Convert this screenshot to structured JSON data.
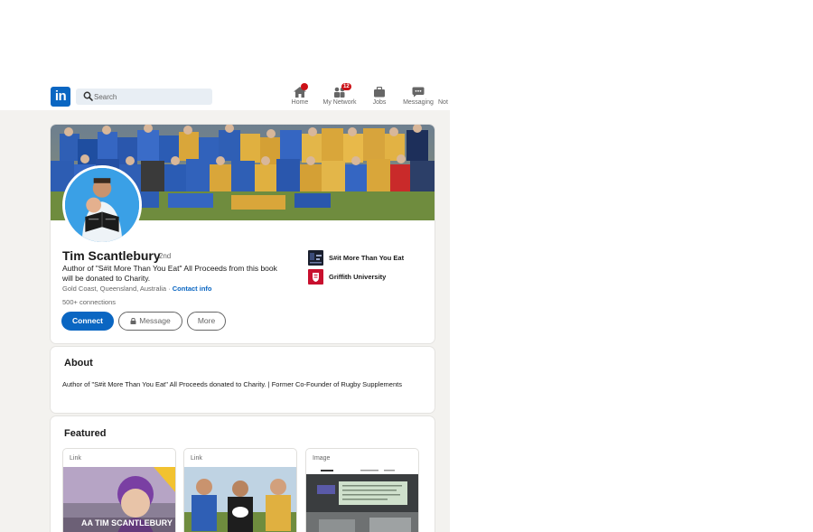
{
  "nav": {
    "logo_text": "in",
    "search_placeholder": "Search",
    "items": [
      {
        "label": "Home",
        "icon": "home-icon",
        "badge": ""
      },
      {
        "label": "My Network",
        "icon": "network-icon",
        "badge": "12"
      },
      {
        "label": "Jobs",
        "icon": "briefcase-icon",
        "badge": ""
      },
      {
        "label": "Messaging",
        "icon": "messaging-icon",
        "badge": ""
      },
      {
        "label": "Not",
        "icon": "notifications-icon",
        "badge": ""
      }
    ]
  },
  "profile": {
    "name": "Tim Scantlebury",
    "degree": "· 2nd",
    "headline": "Author of \"S#it More Than You Eat\" All Proceeds from this book will be donated to Charity.",
    "location": "Gold Coast, Queensland, Australia ·",
    "contact_info": "Contact info",
    "connections_count": "500+",
    "connections_label": "connections",
    "buttons": {
      "connect": "Connect",
      "message": "Message",
      "more": "More"
    },
    "orgs": [
      {
        "name": "S#it More Than You Eat",
        "logo": "book-logo"
      },
      {
        "name": "Griffith University",
        "logo": "griffith-logo"
      }
    ]
  },
  "about": {
    "title": "About",
    "text": "Author of \"S#it More Than You Eat\" All Proceeds donated to Charity. | Former Co-Founder of Rugby Supplements"
  },
  "featured": {
    "title": "Featured",
    "items": [
      {
        "type": "Link",
        "caption": "AA TIM SCANTLEBURY"
      },
      {
        "type": "Link",
        "caption": ""
      },
      {
        "type": "Image",
        "caption": ""
      }
    ]
  },
  "colors": {
    "brand": "#0a66c2",
    "badge": "#cc1016",
    "background": "#f3f2ef"
  }
}
